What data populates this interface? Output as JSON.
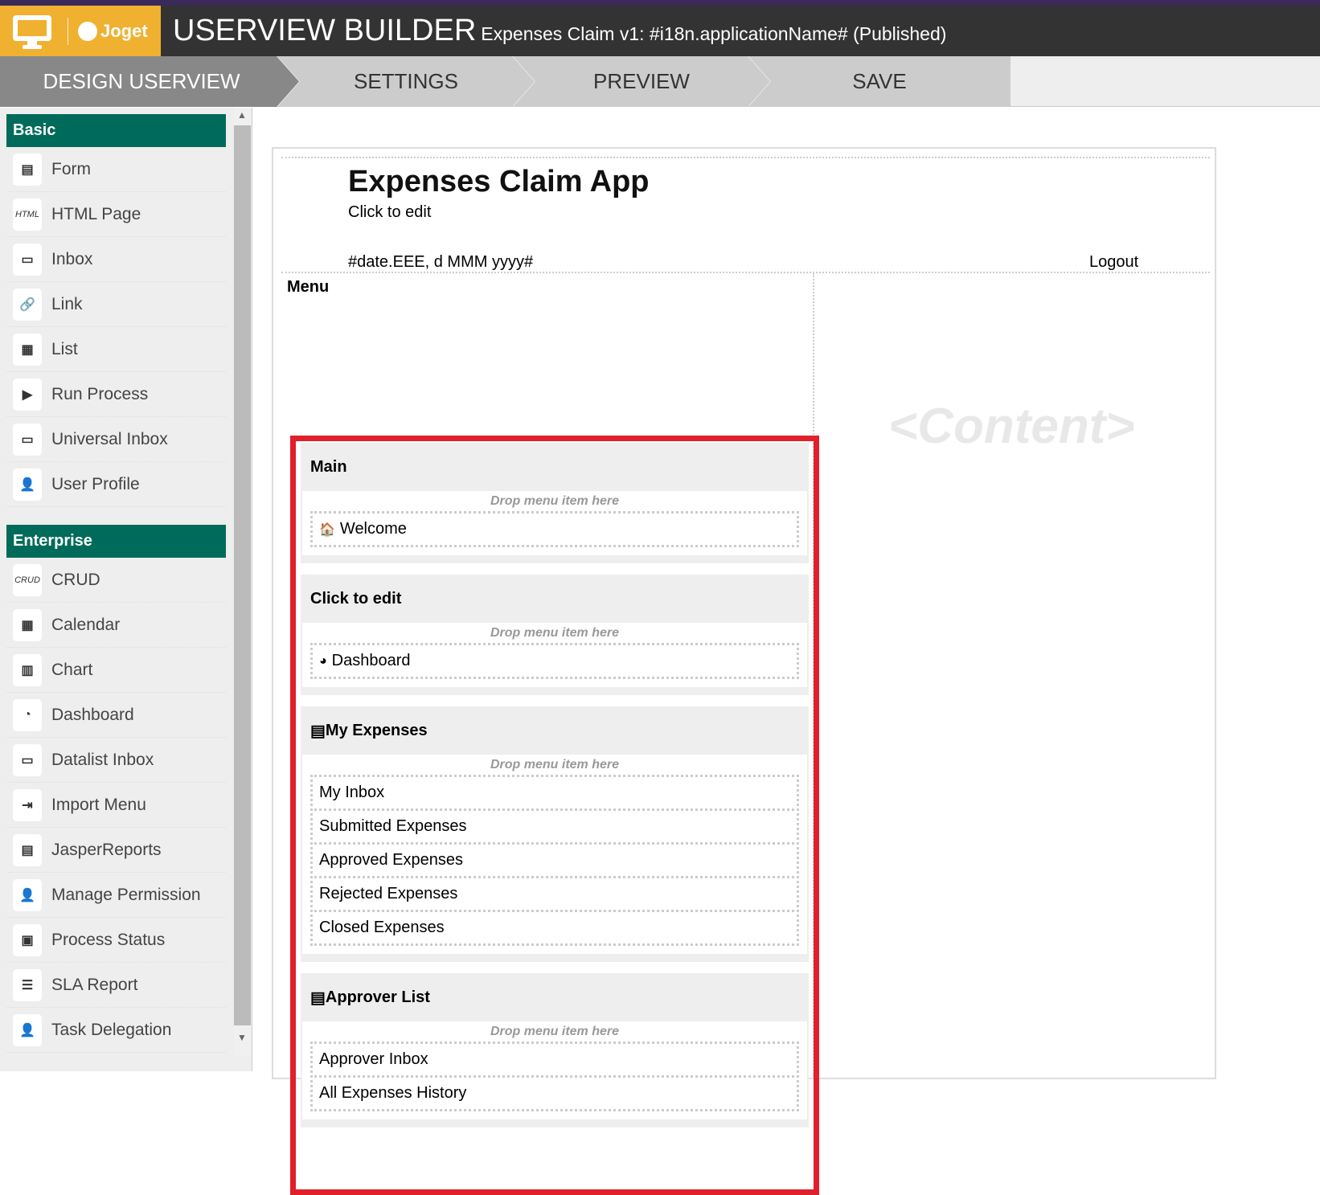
{
  "header": {
    "brand": "Joget",
    "title": "USERVIEW BUILDER",
    "subtitle": "Expenses Claim v1: #i18n.applicationName# (Published)"
  },
  "tabs": [
    {
      "label": "DESIGN USERVIEW"
    },
    {
      "label": "SETTINGS"
    },
    {
      "label": "PREVIEW"
    },
    {
      "label": "SAVE"
    }
  ],
  "sidebar": {
    "basic_label": "Basic",
    "basic": [
      {
        "icon": "form-icon",
        "glyph": "▤",
        "label": "Form"
      },
      {
        "icon": "html-icon",
        "glyph": "HTML",
        "label": "HTML Page"
      },
      {
        "icon": "inbox-icon",
        "glyph": "▭",
        "label": "Inbox"
      },
      {
        "icon": "link-icon",
        "glyph": "🔗",
        "label": "Link"
      },
      {
        "icon": "list-icon",
        "glyph": "▦",
        "label": "List"
      },
      {
        "icon": "play-icon",
        "glyph": "▶",
        "label": "Run Process"
      },
      {
        "icon": "inbox-icon",
        "glyph": "▭",
        "label": "Universal Inbox"
      },
      {
        "icon": "user-edit-icon",
        "glyph": "👤",
        "label": "User Profile"
      }
    ],
    "enterprise_label": "Enterprise",
    "enterprise": [
      {
        "icon": "crud-icon",
        "glyph": "CRUD",
        "label": "CRUD"
      },
      {
        "icon": "calendar-icon",
        "glyph": "▦",
        "label": "Calendar"
      },
      {
        "icon": "chart-icon",
        "glyph": "▥",
        "label": "Chart"
      },
      {
        "icon": "dashboard-icon",
        "glyph": "◔",
        "label": "Dashboard"
      },
      {
        "icon": "inbox-icon",
        "glyph": "▭",
        "label": "Datalist Inbox"
      },
      {
        "icon": "import-icon",
        "glyph": "⇥",
        "label": "Import Menu"
      },
      {
        "icon": "report-icon",
        "glyph": "▤",
        "label": "JasperReports"
      },
      {
        "icon": "user-lock-icon",
        "glyph": "👤",
        "label": "Manage Permission"
      },
      {
        "icon": "process-status-icon",
        "glyph": "▣",
        "label": "Process Status"
      },
      {
        "icon": "sla-icon",
        "glyph": "☰",
        "label": "SLA Report"
      },
      {
        "icon": "user-clock-icon",
        "glyph": "👤",
        "label": "Task Delegation"
      }
    ]
  },
  "canvas": {
    "app_title": "Expenses Claim App",
    "subtitle": "Click to edit",
    "date": "#date.EEE, d MMM yyyy#",
    "logout": "Logout",
    "menu_label": "Menu",
    "content_placeholder": "<Content>",
    "drop_hint": "Drop menu item here",
    "categories": [
      {
        "name": "Main",
        "icon": "",
        "items": [
          {
            "icon": "home-icon",
            "glyph": "🏠",
            "label": "Welcome"
          }
        ]
      },
      {
        "name": "Click to edit",
        "icon": "",
        "items": [
          {
            "icon": "dashboard-icon",
            "glyph": "◕",
            "label": "Dashboard"
          }
        ]
      },
      {
        "name": "My Expenses",
        "icon": "list-alt-icon",
        "glyph": "▤",
        "items": [
          {
            "label": "My Inbox"
          },
          {
            "label": "Submitted Expenses"
          },
          {
            "label": "Approved Expenses"
          },
          {
            "label": "Rejected Expenses"
          },
          {
            "label": "Closed Expenses"
          }
        ]
      },
      {
        "name": "Approver List",
        "icon": "list-alt-icon",
        "glyph": "▤",
        "items": [
          {
            "label": "Approver Inbox"
          },
          {
            "label": "All Expenses History"
          }
        ]
      }
    ]
  },
  "colors": {
    "accent": "#f0b030",
    "section": "#006b5a",
    "highlight": "#e0202a"
  }
}
